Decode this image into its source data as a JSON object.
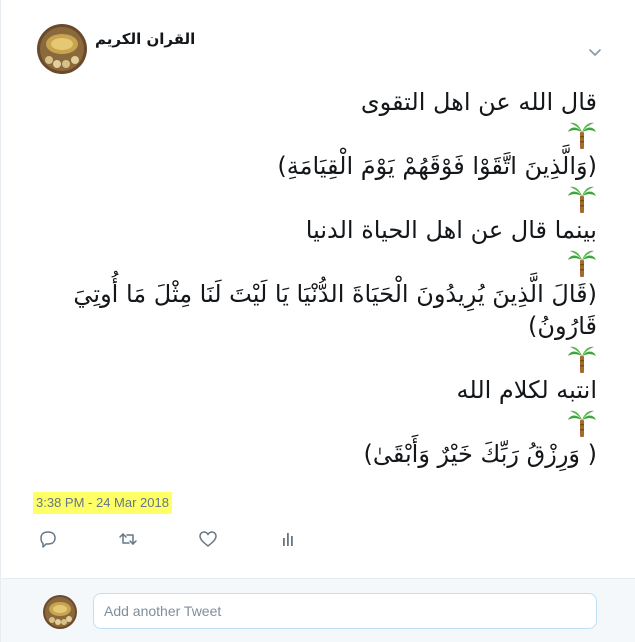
{
  "tweet": {
    "display_name": "القران الكريم",
    "lines": [
      "قال الله عن اهل التقوى",
      "(وَالَّذِينَ اتَّقَوْا فَوْقَهُمْ يَوْمَ الْقِيَامَةِ)",
      "بينما قال عن اهل الحياة الدنيا",
      "(قَالَ الَّذِينَ يُرِيدُونَ الْحَيَاةَ الدُّنْيَا يَا لَيْتَ لَنَا مِثْلَ مَا أُوتِيَ قَارُونُ)",
      "انتبه لكلام الله",
      "( وَرِزْقُ رَبِّكَ خَيْرٌ وَأَبْقَىٰ)"
    ],
    "palm_icon": "palm-tree-emoji",
    "timestamp": "3:38 PM - 24 Mar 2018"
  },
  "actions": [
    {
      "icon": "reply-icon"
    },
    {
      "icon": "retweet-icon"
    },
    {
      "icon": "heart-icon"
    },
    {
      "icon": "analytics-icon"
    }
  ],
  "reply": {
    "placeholder": "Add another Tweet"
  },
  "colors": {
    "text": "#14171a",
    "muted": "#657786",
    "highlight": "#ffff66",
    "reply_bg": "#f5f8fa",
    "input_border": "#bfdff5"
  }
}
